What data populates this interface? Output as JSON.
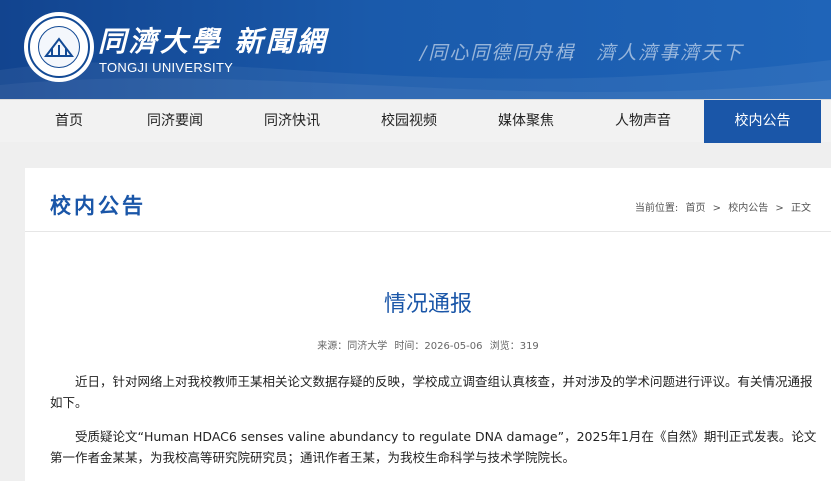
{
  "header": {
    "site_name": "同濟大學 新聞網",
    "site_name_en": "TONGJI UNIVERSITY",
    "slogan": "/同心同德同舟楫　濟人濟事濟天下"
  },
  "nav": {
    "items": [
      {
        "label": "首页"
      },
      {
        "label": "同济要闻"
      },
      {
        "label": "同济快讯"
      },
      {
        "label": "校园视频"
      },
      {
        "label": "媒体聚焦"
      },
      {
        "label": "人物声音"
      },
      {
        "label": "校内公告"
      }
    ],
    "active_index": 6
  },
  "section": {
    "title": "校内公告"
  },
  "breadcrumb": {
    "prefix": "当前位置:",
    "items": [
      "首页",
      ">",
      "校内公告",
      ">",
      "正文"
    ]
  },
  "article": {
    "title": "情况通报",
    "source": "来源：同济大学",
    "time": "时间：2026-05-06",
    "views": "浏览：319",
    "paragraphs": [
      "近日，针对网络上对我校教师王某相关论文数据存疑的反映，学校成立调查组认真核查，并对涉及的学术问题进行评议。有关情况通报如下。",
      "受质疑论文“Human HDAC6 senses valine abundancy to regulate DNA damage”，2025年1月在《自然》期刊正式发表。论文第一作者金某某，为我校高等研究院研究员；通讯作者王某，为我校生命科学与技术学院院长。"
    ]
  },
  "colors": {
    "brand_blue": "#1a56a8",
    "header_blue": "#12448f",
    "nav_bg": "#f2f2f2"
  }
}
